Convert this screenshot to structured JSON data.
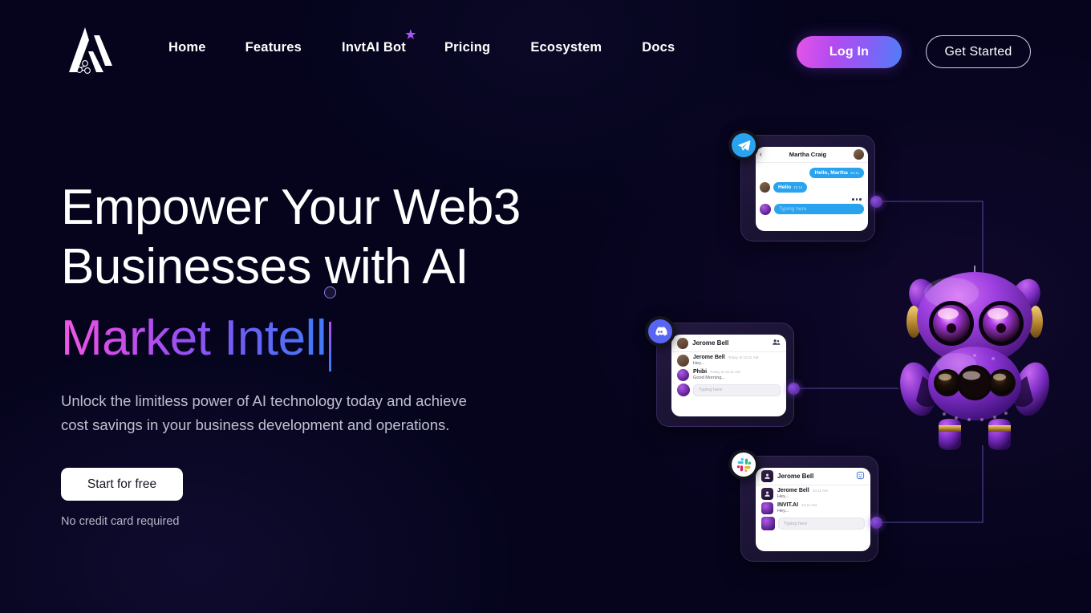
{
  "brand": {
    "logo_name": "invtai-logo"
  },
  "nav": {
    "items": [
      {
        "label": "Home",
        "badge": ""
      },
      {
        "label": "Features",
        "badge": ""
      },
      {
        "label": "InvtAI Bot",
        "badge": "★"
      },
      {
        "label": "Pricing",
        "badge": ""
      },
      {
        "label": "Ecosystem",
        "badge": ""
      },
      {
        "label": "Docs",
        "badge": ""
      }
    ],
    "login_label": "Log In",
    "get_started_label": "Get Started"
  },
  "hero": {
    "headline_line1": "Empower Your Web3",
    "headline_line2": "Businesses with AI",
    "headline_gradient": "Market Intell",
    "subtext": "Unlock the limitless power of AI technology today and achieve cost savings in your business development and operations.",
    "cta_label": "Start for free",
    "cta_note": "No credit card required"
  },
  "illustration": {
    "telegram_card": {
      "platform": "Telegram",
      "title": "Martha Craig",
      "back_glyph": "‹",
      "messages": [
        {
          "side": "right",
          "text": "Hello, Martha",
          "time": "10:11"
        },
        {
          "side": "left",
          "text": "Hello",
          "time": "10:11"
        }
      ],
      "input_placeholder": "Typing here"
    },
    "discord_card": {
      "platform": "Discord",
      "title": "Jerome Bell",
      "messages": [
        {
          "author": "Jerome Bell",
          "time": "Today at 10:11 AM",
          "text": "Hey..."
        },
        {
          "author": "Phibi",
          "time": "Today at 10:11 AM",
          "text": "Good Morning..."
        }
      ],
      "input_placeholder": "Typing here"
    },
    "slack_card": {
      "platform": "Slack",
      "title": "Jerome Bell",
      "messages": [
        {
          "author": "Jerome Bell",
          "time": "10:11 AM",
          "text": "Hey..."
        },
        {
          "author": "INVIT.AI",
          "time": "10:11 AM",
          "text": "Hey..."
        }
      ],
      "input_placeholder": "Typing here"
    },
    "mascot_name": "phibi-robot-mascot"
  },
  "colors": {
    "background": "#05041c",
    "accent_pink": "#e555e8",
    "accent_purple": "#8b5cf6",
    "accent_blue": "#4f7ef7",
    "telegram_blue": "#2aa3ef",
    "discord_blurple": "#5865f2",
    "text_primary": "#ffffff",
    "text_muted": "#bfc0cf"
  }
}
